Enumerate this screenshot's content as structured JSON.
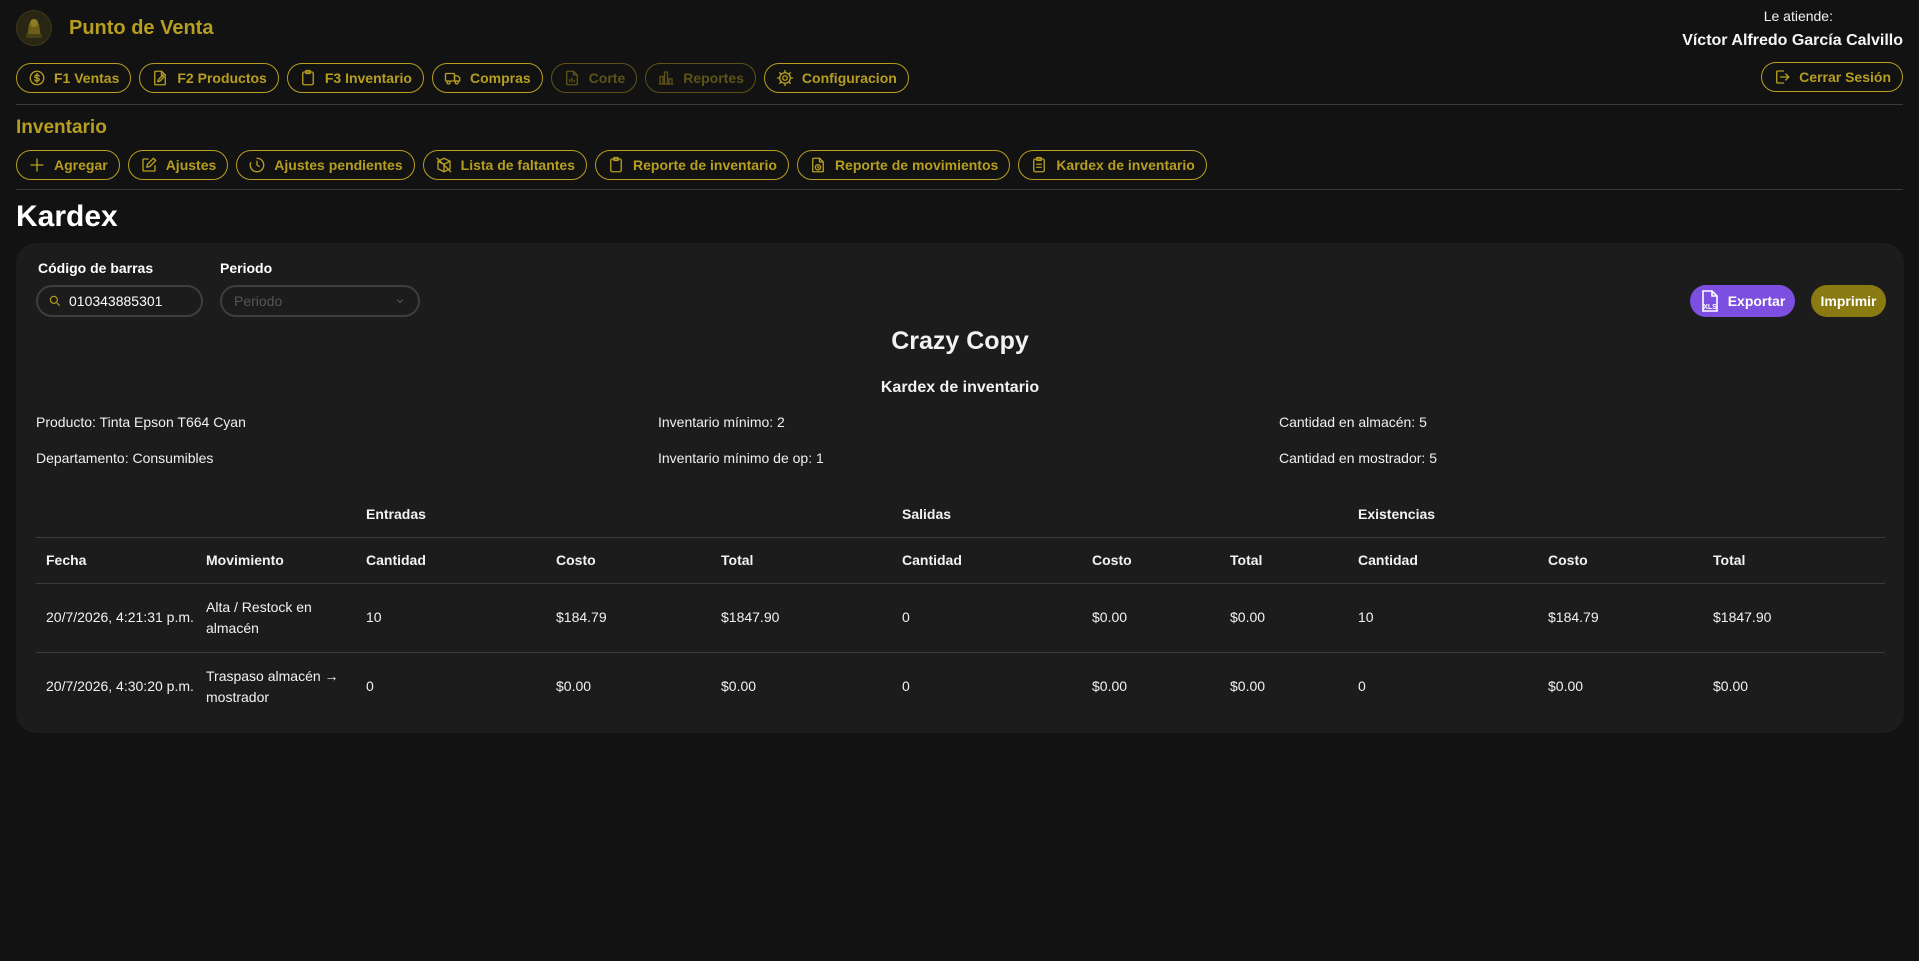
{
  "app": {
    "title": "Punto de Venta"
  },
  "user": {
    "label": "Le atiende:",
    "name": "Víctor Alfredo García Calvillo"
  },
  "main_nav": [
    {
      "label": "F1 Ventas",
      "icon": "dollar-icon",
      "disabled": false
    },
    {
      "label": "F2 Productos",
      "icon": "document-edit-icon",
      "disabled": false
    },
    {
      "label": "F3 Inventario",
      "icon": "clipboard-icon",
      "disabled": false
    },
    {
      "label": "Compras",
      "icon": "truck-icon",
      "disabled": false
    },
    {
      "label": "Corte",
      "icon": "file-chart-icon",
      "disabled": true
    },
    {
      "label": "Reportes",
      "icon": "bar-chart-icon",
      "disabled": true
    },
    {
      "label": "Configuracion",
      "icon": "gear-icon",
      "disabled": false
    }
  ],
  "logout_label": "Cerrar Sesión",
  "section_title": "Inventario",
  "sub_nav": [
    {
      "label": "Agregar",
      "icon": "plus-icon"
    },
    {
      "label": "Ajustes",
      "icon": "edit-icon"
    },
    {
      "label": "Ajustes pendientes",
      "icon": "clock-icon"
    },
    {
      "label": "Lista de faltantes",
      "icon": "box-off-icon"
    },
    {
      "label": "Reporte de inventario",
      "icon": "clipboard-icon"
    },
    {
      "label": "Reporte de movimientos",
      "icon": "file-clock-icon"
    },
    {
      "label": "Kardex de inventario",
      "icon": "clipboard-list-icon"
    }
  ],
  "page_title": "Kardex",
  "filters": {
    "barcode_label": "Código de barras",
    "barcode_value": "010343885301",
    "period_label": "Periodo",
    "period_placeholder": "Periodo"
  },
  "actions": {
    "export_label": "Exportar",
    "export_badge": "XLS",
    "print_label": "Imprimir"
  },
  "report": {
    "company": "Crazy Copy",
    "title": "Kardex de inventario",
    "info": {
      "producto": "Producto: Tinta Epson T664 Cyan",
      "departamento": "Departamento: Consumibles",
      "inv_min": "Inventario mínimo: 2",
      "inv_min_op": "Inventario mínimo de op: 1",
      "cant_almacen": "Cantidad en almacén: 5",
      "cant_mostrador": "Cantidad en mostrador: 5"
    }
  },
  "table": {
    "groups": [
      "Entradas",
      "Salidas",
      "Existencias"
    ],
    "columns": [
      "Fecha",
      "Movimiento",
      "Cantidad",
      "Costo",
      "Total",
      "Cantidad",
      "Costo",
      "Total",
      "Cantidad",
      "Costo",
      "Total"
    ],
    "rows": [
      [
        "20/7/2026, 4:21:31 p.m.",
        "Alta / Restock en almacén",
        "10",
        "$184.79",
        "$1847.90",
        "0",
        "$0.00",
        "$0.00",
        "10",
        "$184.79",
        "$1847.90"
      ],
      [
        "20/7/2026, 4:30:20 p.m.",
        "Traspaso almacén → mostrador",
        "0",
        "$0.00",
        "$0.00",
        "0",
        "$0.00",
        "$0.00",
        "0",
        "$0.00",
        "$0.00"
      ]
    ]
  },
  "colors": {
    "accent": "#b59e21",
    "export": "#7c4fe0",
    "print": "#8a7a12",
    "background": "#121212",
    "card": "#1c1c1c"
  }
}
